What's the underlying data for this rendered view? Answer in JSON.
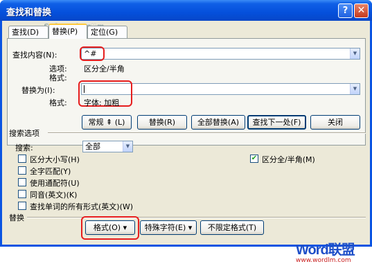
{
  "window": {
    "title": "查找和替换",
    "help_label": "?",
    "close_label": "✕"
  },
  "tabs": [
    {
      "label": "查找(D)"
    },
    {
      "label": "替换(P)"
    },
    {
      "label": "定位(G)"
    }
  ],
  "find": {
    "label": "查找内容(N):",
    "value": "^#",
    "options_label": "选项:",
    "options_value": "区分全/半角",
    "format_label": "格式:"
  },
  "replace": {
    "label": "替换为(I):",
    "value": "",
    "format_label": "格式:",
    "format_value": "字体: 加粗"
  },
  "buttons": {
    "normal": "常规 ⇞ (L)",
    "replace": "替换(R)",
    "replace_all": "全部替换(A)",
    "find_next": "查找下一处(F)",
    "close": "关闭"
  },
  "search_options": {
    "heading": "搜索选项",
    "search_label": "搜索:",
    "search_value": "全部",
    "checkboxes": [
      {
        "label": "区分大小写(H)",
        "checked": false
      },
      {
        "label": "全字匹配(Y)",
        "checked": false
      },
      {
        "label": "使用通配符(U)",
        "checked": false
      },
      {
        "label": "同音(英文)(K)",
        "checked": false
      },
      {
        "label": "查找单词的所有形式(英文)(W)",
        "checked": false
      }
    ],
    "fullwidth": {
      "label": "区分全/半角(M)",
      "checked": true
    }
  },
  "replace_section": {
    "heading": "替换",
    "format_button": "格式(O) ▾",
    "special_button": "特殊字符(E) ▾",
    "noformat_button": "不限定格式(T)"
  },
  "watermark": {
    "brand": "Word联盟",
    "url": "www.wordlm.com",
    "site": "Soft.Yesky.c♡m"
  },
  "colors": {
    "titlebar": "#0550dc",
    "dialog_bg": "#ece9d8",
    "highlight": "#e61e1e"
  }
}
